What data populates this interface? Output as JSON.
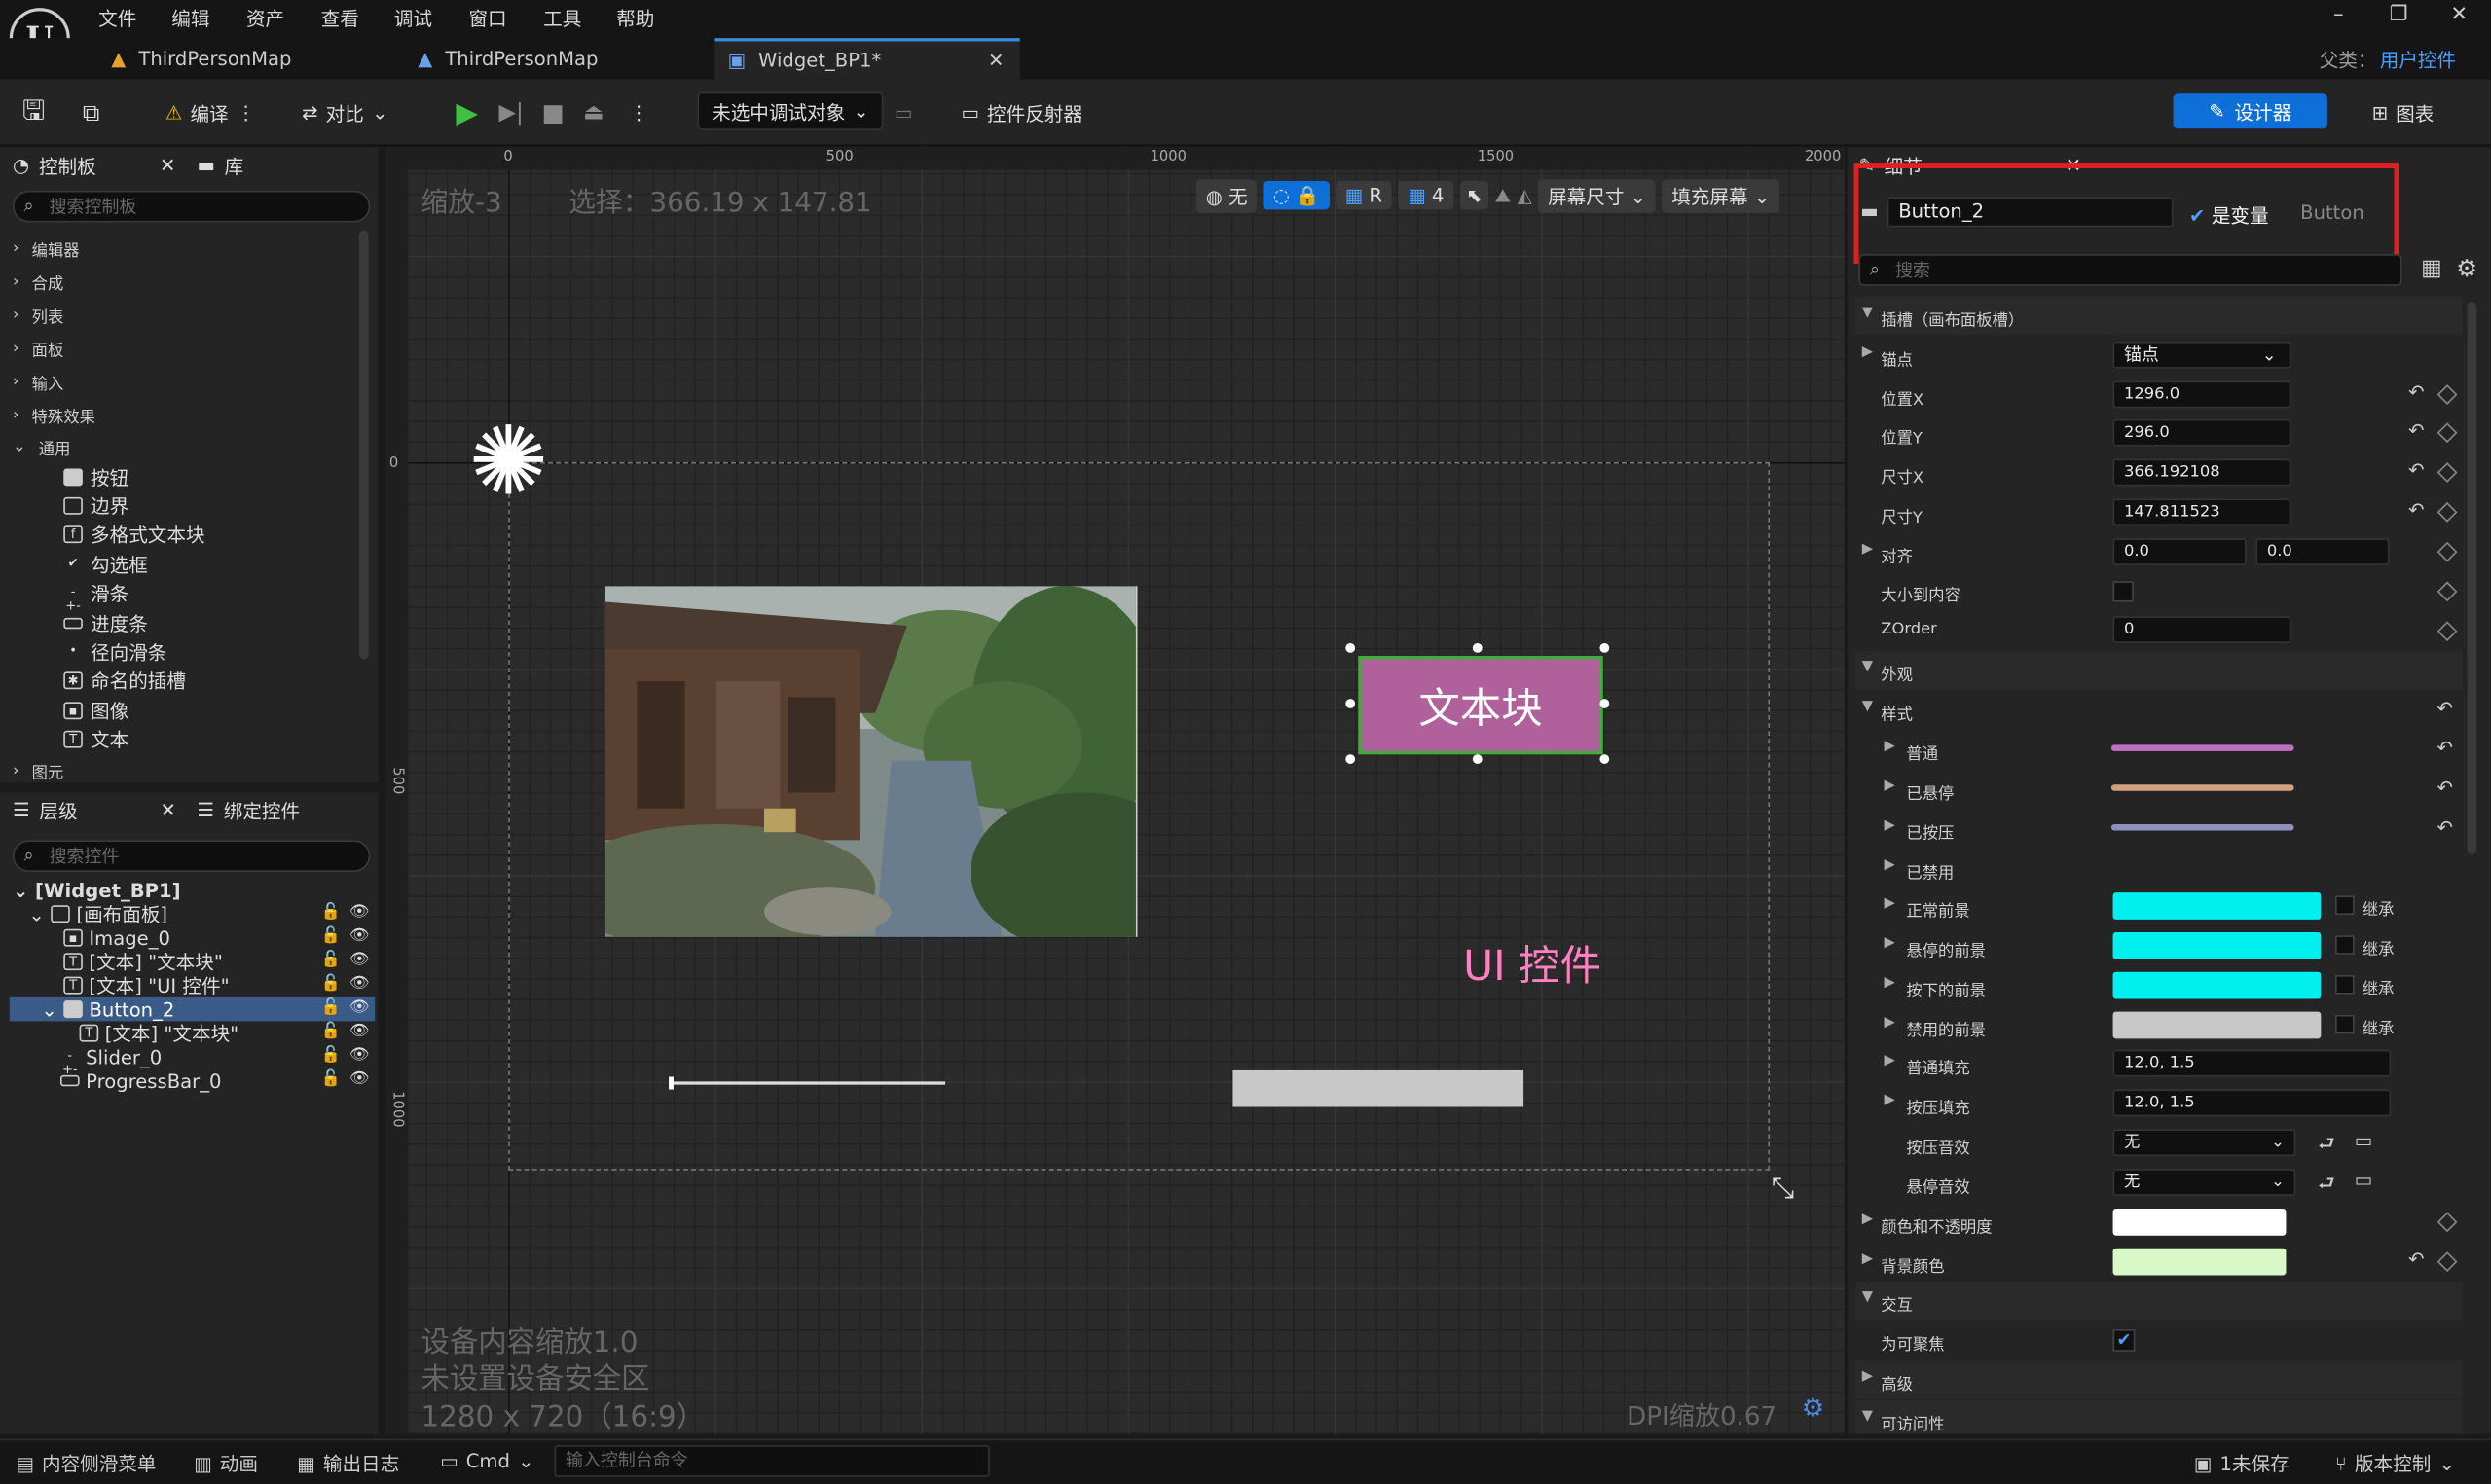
{
  "menu": [
    "文件",
    "编辑",
    "资产",
    "查看",
    "调试",
    "窗口",
    "工具",
    "帮助"
  ],
  "tabs": [
    {
      "label": "ThirdPersonMap"
    },
    {
      "label": "ThirdPersonMap"
    },
    {
      "label": "Widget_BP1*"
    }
  ],
  "parent_class": {
    "label": "父类：",
    "value": "用户控件"
  },
  "toolbar": {
    "compile": "编译",
    "diff": "对比",
    "debug_target": "未选中调试对象",
    "reflector": "控件反射器",
    "designer": "设计器",
    "graph": "图表"
  },
  "palette": {
    "title": "控制板",
    "library_tab": "库",
    "search_placeholder": "搜索控制板",
    "categories": [
      "编辑器",
      "合成",
      "列表",
      "面板",
      "输入",
      "特殊效果",
      "通用"
    ],
    "common_items": [
      {
        "label": "按钮",
        "icon": "button-icon"
      },
      {
        "label": "边界",
        "icon": "border-icon"
      },
      {
        "label": "多格式文本块",
        "icon": "richtext-icon"
      },
      {
        "label": "勾选框",
        "icon": "checkbox-icon"
      },
      {
        "label": "滑条",
        "icon": "slider-icon"
      },
      {
        "label": "进度条",
        "icon": "progressbar-icon"
      },
      {
        "label": "径向滑条",
        "icon": "radial-slider-icon"
      },
      {
        "label": "命名的插槽",
        "icon": "named-slot-icon"
      },
      {
        "label": "图像",
        "icon": "image-icon"
      },
      {
        "label": "文本",
        "icon": "text-icon"
      }
    ],
    "last_category": "图元"
  },
  "hierarchy": {
    "title": "层级",
    "bind_tab": "绑定控件",
    "search_placeholder": "搜索控件",
    "root": "[Widget_BP1]",
    "items": [
      "[画布面板]",
      "Image_0",
      "[文本] \"文本块\"",
      "[文本] \"UI 控件\"",
      "Button_2",
      "[文本] \"文本块\"",
      "Slider_0",
      "ProgressBar_0"
    ]
  },
  "canvas": {
    "zoom": "缩放-3",
    "selection": "选择：366.19 x 147.81",
    "ruler_ticks": [
      "0",
      "500",
      "1000",
      "1500",
      "2000"
    ],
    "vruler_ticks": [
      "0",
      "500",
      "1000"
    ],
    "tools": {
      "none": "无",
      "r": "R",
      "grid": "4",
      "screen_size": "屏幕尺寸",
      "fill_screen": "填充屏幕"
    },
    "button_text": "文本块",
    "ui_text": "UI 控件",
    "device_scale": "设备内容缩放1.0",
    "safe_zone": "未设置设备安全区",
    "resolution": "1280 x 720（16:9）",
    "dpi": "DPI缩放0.67"
  },
  "details": {
    "title": "细节",
    "name_value": "Button_2",
    "is_variable": "是变量",
    "class_name": "Button",
    "search_placeholder": "搜索",
    "slot_section": "插槽（画布面板槽）",
    "anchor_label": "锚点",
    "anchor_value": "锚点",
    "pos_x_label": "位置X",
    "pos_x": "1296.0",
    "pos_y_label": "位置Y",
    "pos_y": "296.0",
    "size_x_label": "尺寸X",
    "size_x": "366.192108",
    "size_y_label": "尺寸Y",
    "size_y": "147.811523",
    "align_label": "对齐",
    "align_x": "0.0",
    "align_y": "0.0",
    "size_to_content": "大小到内容",
    "zorder_label": "ZOrder",
    "zorder": "0",
    "appearance": "外观",
    "style": "样式",
    "normal": "普通",
    "hovered": "已悬停",
    "pressed": "已按压",
    "disabled": "已禁用",
    "normal_fg": "正常前景",
    "hovered_fg": "悬停的前景",
    "pressed_fg": "按下的前景",
    "disabled_fg": "禁用的前景",
    "inherit": "继承",
    "normal_padding_label": "普通填充",
    "normal_padding": "12.0, 1.5",
    "pressed_padding_label": "按压填充",
    "pressed_padding": "12.0, 1.5",
    "press_sound": "按压音效",
    "hover_sound": "悬停音效",
    "sound_value": "无",
    "color_opacity": "颜色和不透明度",
    "bg_color": "背景颜色",
    "interaction": "交互",
    "focusable": "为可聚焦",
    "advanced": "高级",
    "accessibility": "可访问性"
  },
  "colors": {
    "accent": "#0e6fd8",
    "highlight": "#e02020",
    "normal_brush": "#c070c0",
    "hovered_brush": "#d0a080",
    "pressed_brush": "#9090c0",
    "fg_cyan": "#00f0f0",
    "fg_gray": "#c8c8c8",
    "bg_color": "#d8f8c8",
    "button_fill": "#b0609a"
  },
  "status": {
    "content_drawer": "内容侧滑菜单",
    "animation": "动画",
    "output_log": "输出日志",
    "cmd": "Cmd",
    "console_placeholder": "输入控制台命令",
    "unsaved": "1未保存",
    "source_control": "版本控制"
  }
}
